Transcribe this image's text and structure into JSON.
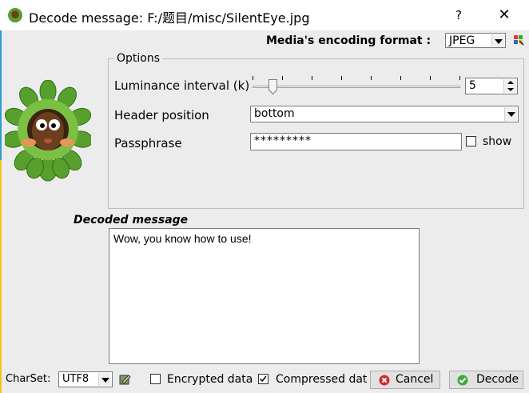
{
  "window": {
    "title": "Decode message: F:/题目/misc/SilentEye.jpg",
    "help_glyph": "?",
    "close_glyph": "✕"
  },
  "media": {
    "format_label": "Media's encoding format :",
    "format_value": "JPEG"
  },
  "options": {
    "group_title": "Options",
    "luminance_label": "Luminance interval (k)",
    "luminance_value": "5",
    "luminance_slider_fraction": 0.08,
    "header_label": "Header position",
    "header_value": "bottom",
    "passphrase_label": "Passphrase",
    "passphrase_value": "*********",
    "show_label": "show",
    "show_checked": false
  },
  "decoded": {
    "label": "Decoded message",
    "text": "Wow, you know how to use!"
  },
  "footer": {
    "charset_label": "CharSet:",
    "charset_value": "UTF8",
    "encrypted_label": "Encrypted data",
    "encrypted_checked": false,
    "compressed_label": "Compressed dat",
    "compressed_checked": true,
    "cancel_label": "Cancel",
    "decode_label": "Decode"
  },
  "colors": {
    "cancel_icon": "#d62b2b",
    "decode_icon": "#3fa83a",
    "leaf_green": "#58a02e",
    "face_brown": "#6b3f1d"
  }
}
